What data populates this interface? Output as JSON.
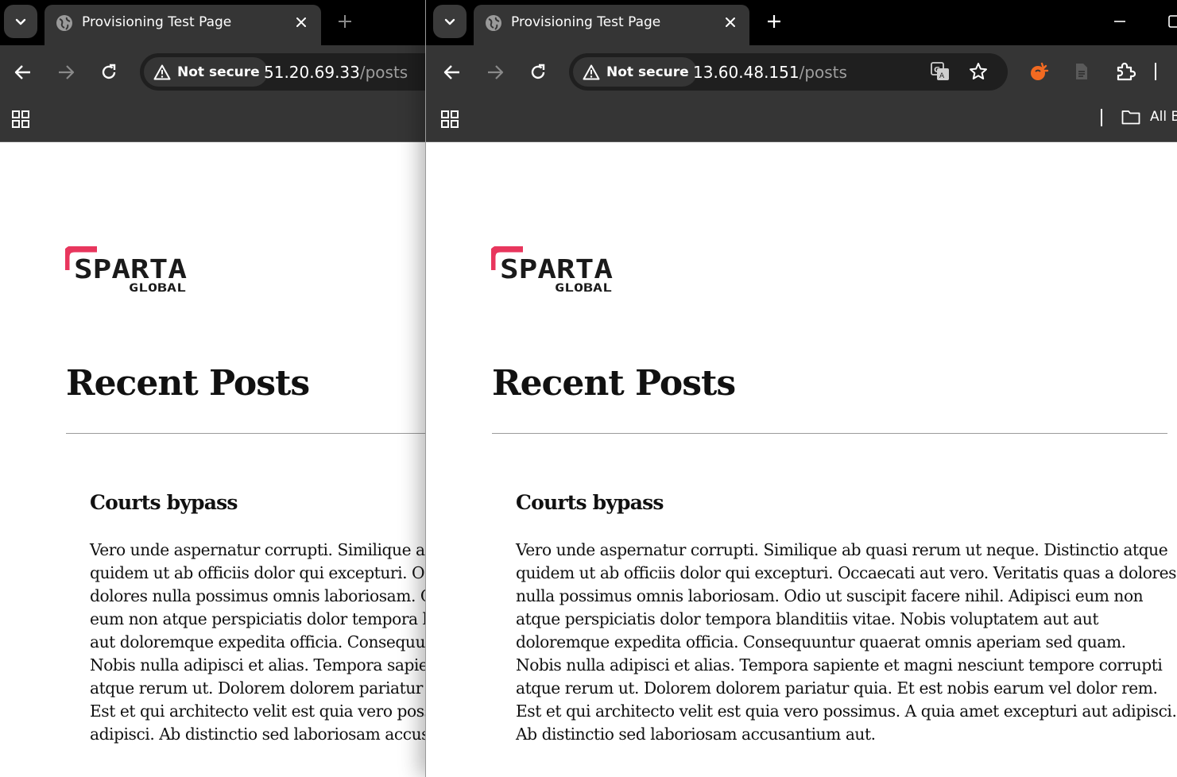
{
  "colors": {
    "accent": "#e8365d",
    "chrome_dark": "#353535",
    "titlebar": "#000000",
    "omnibox": "#1f1f1f"
  },
  "browser_left": {
    "tab_title": "Provisioning Test Page",
    "security_label": "Not secure",
    "url_host": "51.20.69.33",
    "url_path": "/posts"
  },
  "browser_right": {
    "tab_title": "Provisioning Test Page",
    "security_label": "Not secure",
    "url_host": "13.60.48.151",
    "url_path": "/posts",
    "bookmarks_folder": "All B"
  },
  "page": {
    "logo_text": "SPARTA",
    "logo_subtext": "GLOBAL",
    "heading": "Recent Posts",
    "post": {
      "title": "Courts bypass",
      "lines_wide": [
        "Vero unde aspernatur corrupti. Similique ab quasi rerum ut neque. Distinctio atque",
        "quidem ut ab officiis dolor qui excepturi. Occaecati aut vero. Veritatis quas a dolores",
        "nulla possimus omnis laboriosam. Odio ut suscipit facere nihil. Adipisci eum non",
        "atque perspiciatis dolor tempora blanditiis vitae. Nobis voluptatem aut aut",
        "doloremque expedita officia. Consequuntur quaerat omnis aperiam sed quam.",
        "Nobis nulla adipisci et alias. Tempora sapiente et magni nesciunt tempore corrupti",
        "atque rerum ut. Dolorem dolorem pariatur quia. Et est nobis earum vel dolor rem.",
        "Est et qui architecto velit est quia vero possimus. A quia amet excepturi aut adipisci.",
        "Ab distinctio sed laboriosam accusantium aut."
      ],
      "lines_narrow": [
        "Vero unde aspernatur corrupti. Similique ab quasi rerum ut neque.",
        "quidem ut ab officiis dolor qui excepturi. Occaecati aut vero.",
        "dolores nulla possimus omnis laboriosam. Odio ut suscipit facere",
        "eum non atque perspiciatis dolor tempora blanditiis vitae. Nobis",
        "aut doloremque expedita officia. Consequuntur quaerat omnis",
        "Nobis nulla adipisci et alias. Tempora sapiente et magni nesciunt",
        "atque rerum ut. Dolorem dolorem pariatur quia. Et est nobis",
        "Est et qui architecto velit est quia vero possimus. A quia amet",
        "adipisci. Ab distinctio sed laboriosam accusantium aut."
      ]
    }
  }
}
